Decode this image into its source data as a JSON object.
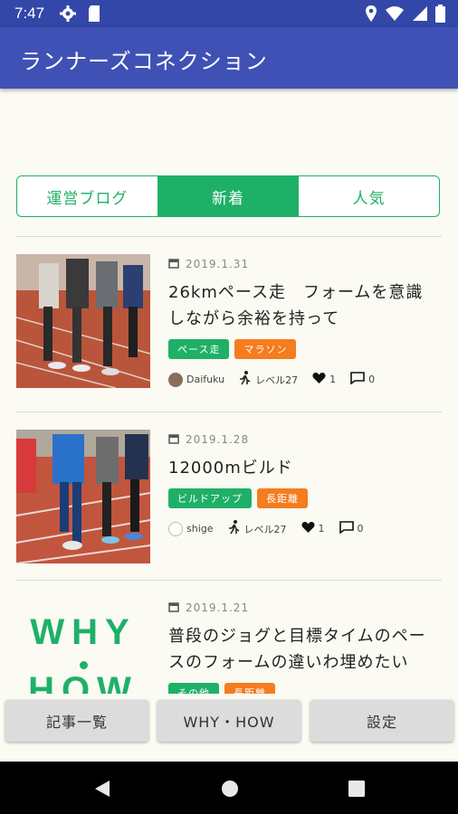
{
  "status_bar": {
    "time": "7:47",
    "icons": [
      "gear-icon",
      "sd-card-icon",
      "location-icon",
      "wifi-icon",
      "signal-icon",
      "battery-icon"
    ]
  },
  "app_bar": {
    "title": "ランナーズコネクション"
  },
  "tabs": [
    {
      "label": "運営ブログ",
      "active": false
    },
    {
      "label": "新着",
      "active": true
    },
    {
      "label": "人気",
      "active": false
    }
  ],
  "articles": [
    {
      "date": "2019.1.31",
      "title": "26kmペース走　フォームを意識しながら余裕を持って",
      "tags": [
        {
          "label": "ペース走",
          "color": "green"
        },
        {
          "label": "マラソン",
          "color": "orange"
        }
      ],
      "author": "Daifuku",
      "level": "レベル27",
      "likes": "1",
      "comments": "0"
    },
    {
      "date": "2019.1.28",
      "title": "12000mビルド",
      "tags": [
        {
          "label": "ビルドアップ",
          "color": "green"
        },
        {
          "label": "長距離",
          "color": "orange"
        }
      ],
      "author": "shige",
      "level": "レベル27",
      "likes": "1",
      "comments": "0"
    },
    {
      "date": "2019.1.21",
      "title": "普段のジョグと目標タイムのペースのフォームの違いわ埋めたい",
      "thumb_text_1": "WHY",
      "thumb_text_2": "HOW",
      "tags": [
        {
          "label": "その他",
          "color": "green"
        },
        {
          "label": "長距離",
          "color": "orange"
        }
      ]
    }
  ],
  "bottom_buttons": {
    "list": "記事一覧",
    "why_how": "WHY・HOW",
    "settings": "設定"
  },
  "colors": {
    "accent_green": "#1fb068",
    "accent_orange": "#f57c1f",
    "app_bar": "#3f51b5",
    "status_bar": "#3347a8"
  }
}
